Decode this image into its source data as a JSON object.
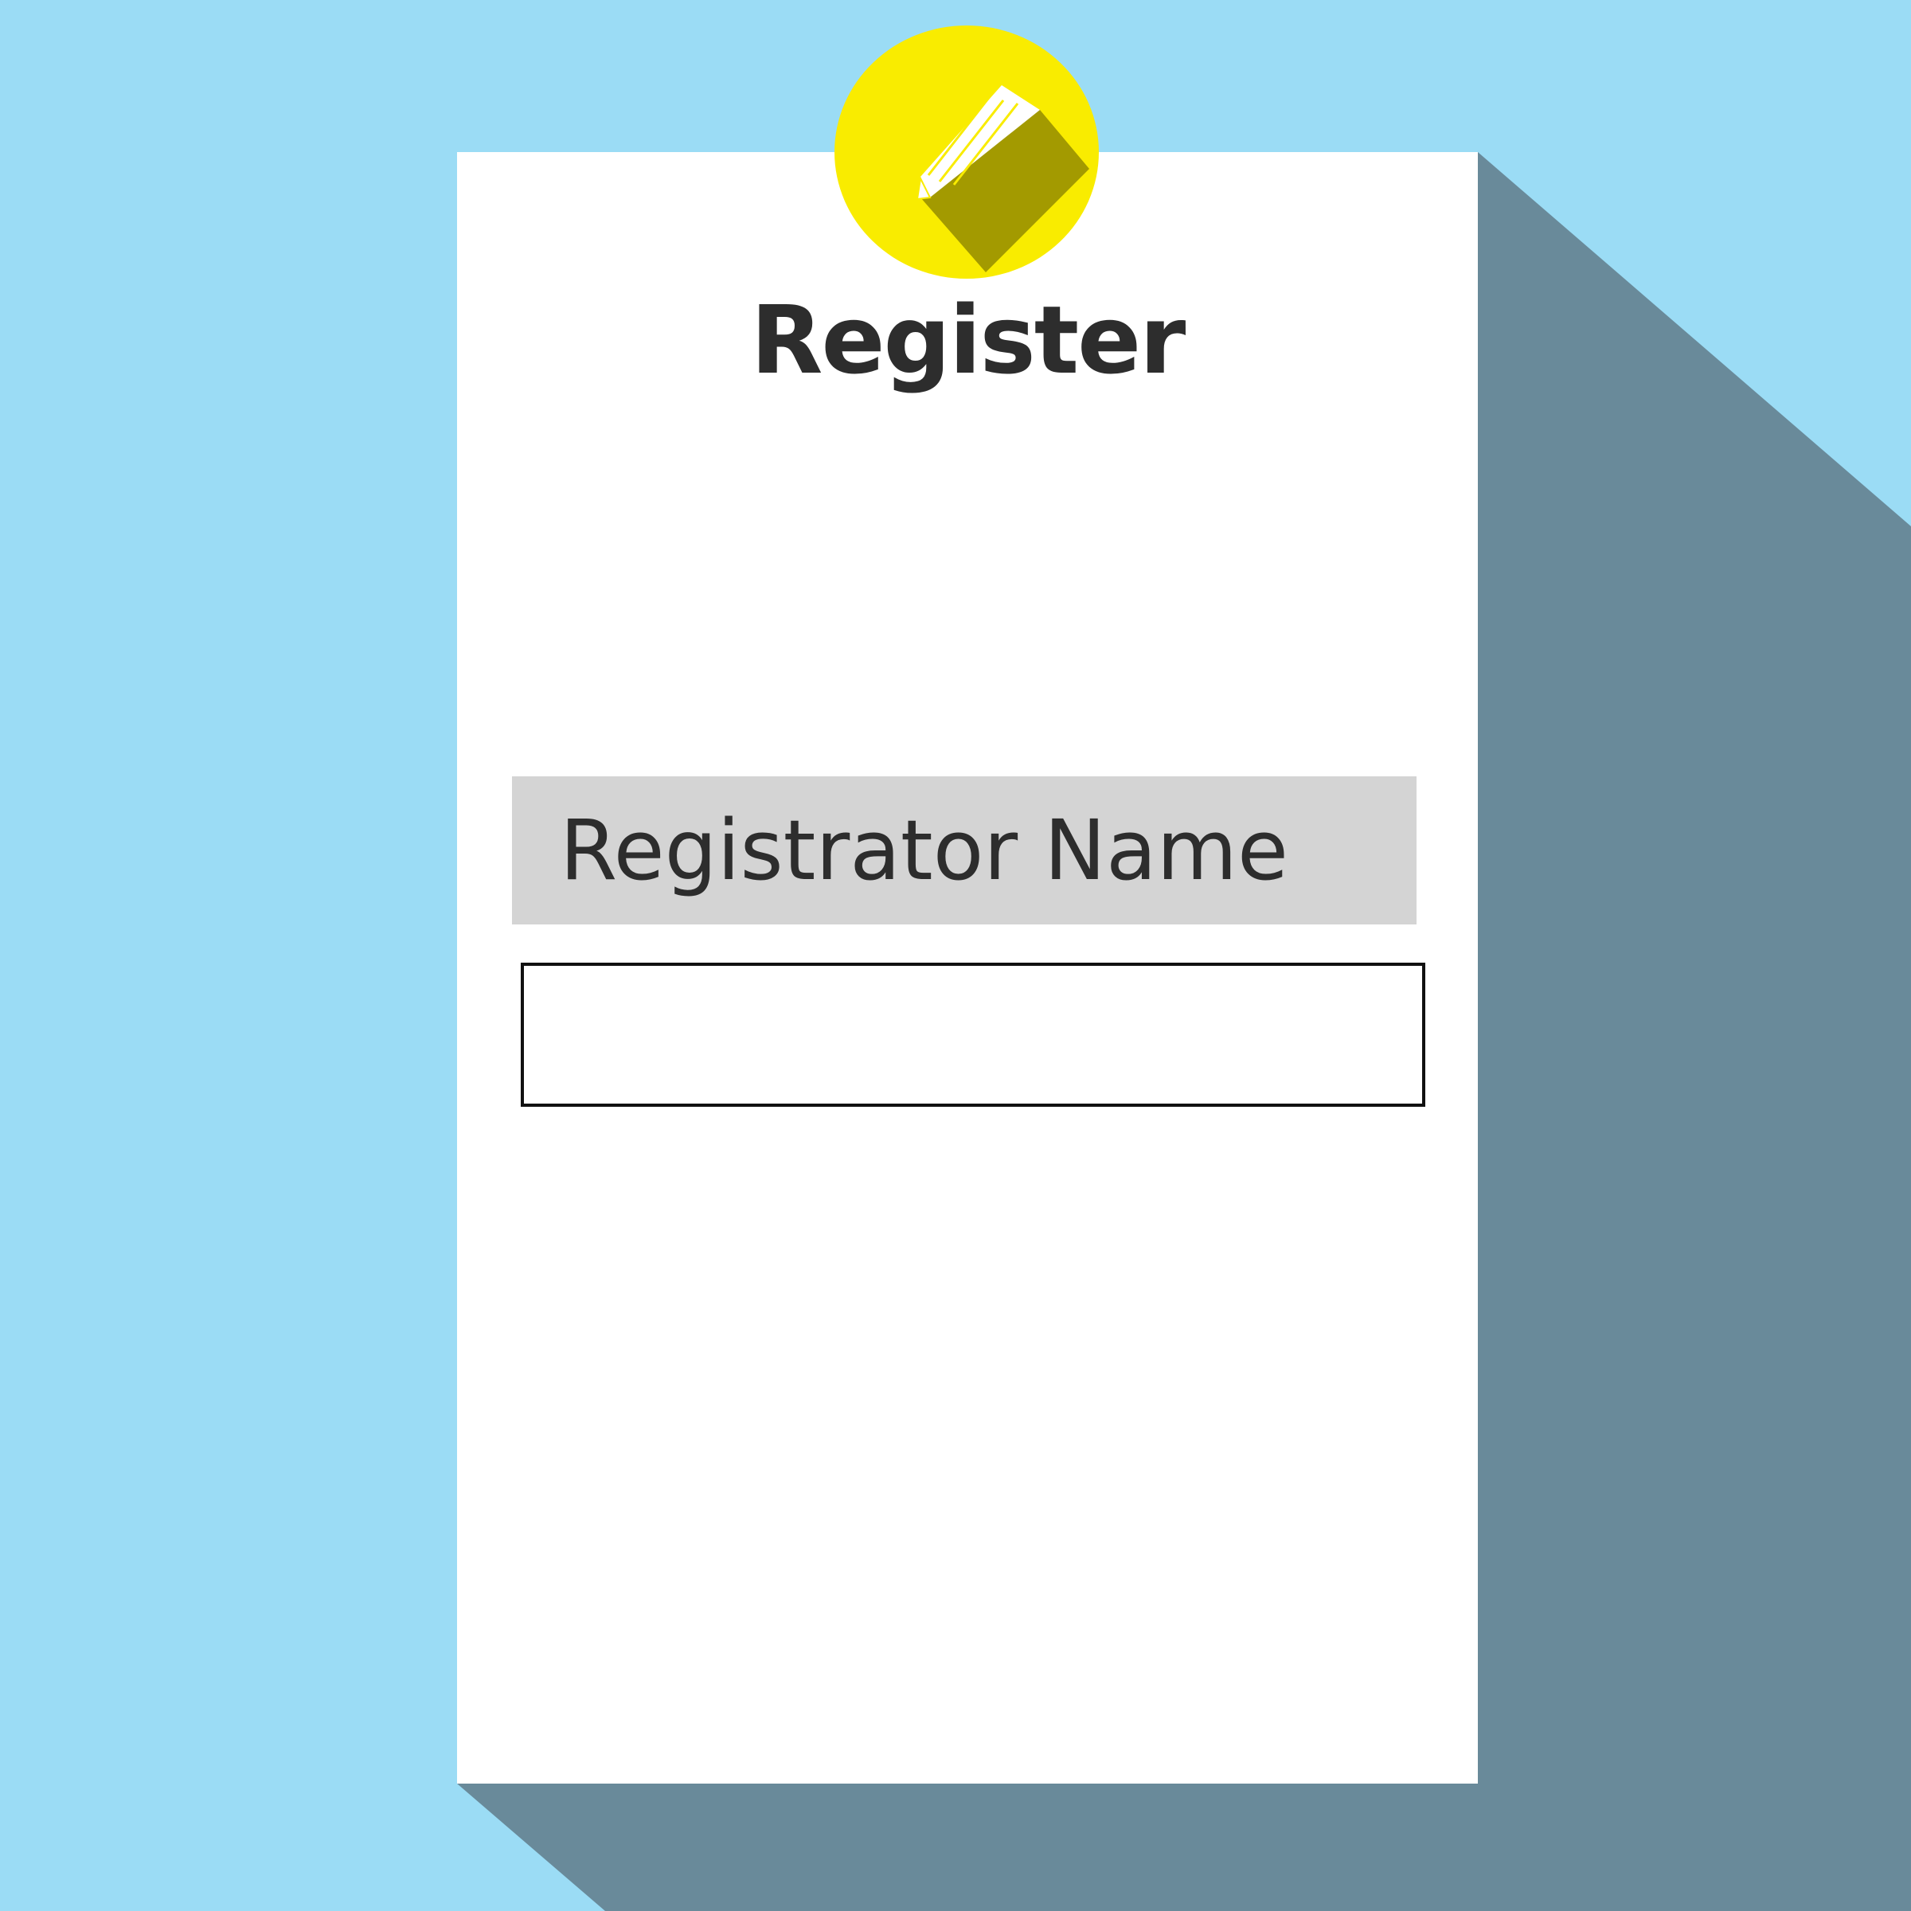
{
  "form": {
    "title": "Register",
    "field_label": "Registrator Name",
    "field_value": ""
  },
  "icons": {
    "badge": "pencil-icon"
  },
  "colors": {
    "background": "#9bdcf5",
    "shadow": "#698a9a",
    "card": "#ffffff",
    "badge": "#f9ec00",
    "label_bg": "#d4d4d4",
    "text": "#2d2d2d"
  }
}
